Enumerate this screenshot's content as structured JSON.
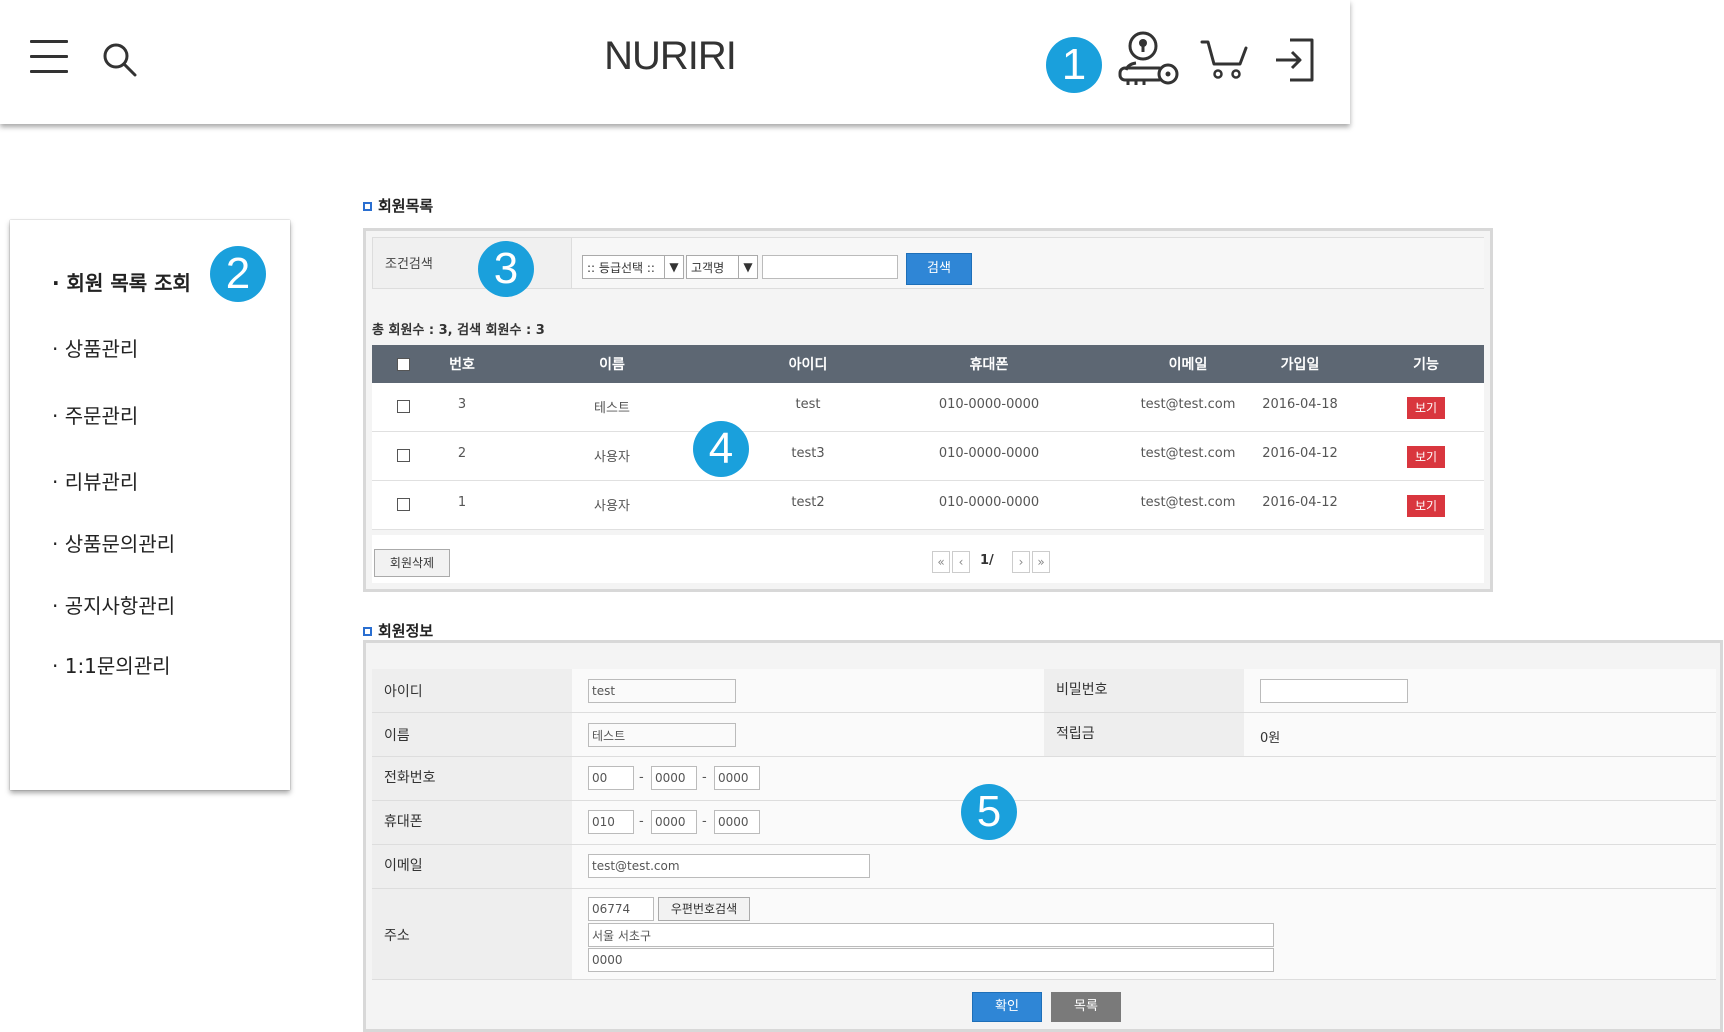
{
  "header": {
    "brand": "NURIRI",
    "icons": [
      "menu-icon",
      "search-icon",
      "admin-key-icon",
      "cart-icon",
      "logout-icon"
    ]
  },
  "callouts": {
    "c1": "1",
    "c2": "2",
    "c3": "3",
    "c4": "4",
    "c5": "5"
  },
  "sidebar": {
    "items": [
      {
        "label": "· 회원 목록 조회"
      },
      {
        "label": "· 상품관리"
      },
      {
        "label": "· 주문관리"
      },
      {
        "label": "· 리뷰관리"
      },
      {
        "label": "· 상품문의관리"
      },
      {
        "label": "· 공지사항관리"
      },
      {
        "label": "· 1:1문의관리"
      }
    ]
  },
  "member_list": {
    "title": "회원목록",
    "search": {
      "label": "조건검색",
      "grade_select": ":: 등급선택 ::",
      "field_select": "고객명",
      "keyword": "",
      "button": "검색"
    },
    "count_text": "총 회원수 : 3, 검색 회원수 : 3",
    "columns": [
      "번호",
      "이름",
      "아이디",
      "휴대폰",
      "이메일",
      "가입일",
      "기능"
    ],
    "rows": [
      {
        "no": "3",
        "name": "테스트",
        "id": "test",
        "phone": "010-0000-0000",
        "email": "test@test.com",
        "joined": "2016-04-18",
        "action": "보기"
      },
      {
        "no": "2",
        "name": "사용자",
        "id": "test3",
        "phone": "010-0000-0000",
        "email": "test@test.com",
        "joined": "2016-04-12",
        "action": "보기"
      },
      {
        "no": "1",
        "name": "사용자",
        "id": "test2",
        "phone": "010-0000-0000",
        "email": "test@test.com",
        "joined": "2016-04-12",
        "action": "보기"
      }
    ],
    "delete_button": "회원삭제",
    "pagination": {
      "first": "«",
      "prev": "‹",
      "page": "1/",
      "next": "›",
      "last": "»"
    }
  },
  "member_info": {
    "title": "회원정보",
    "labels": {
      "id": "아이디",
      "password": "비밀번호",
      "name": "이름",
      "points": "적립금",
      "tel": "전화번호",
      "mobile": "휴대폰",
      "email": "이메일",
      "address": "주소"
    },
    "values": {
      "id": "test",
      "password": "",
      "name": "테스트",
      "points": "0원",
      "tel1": "00",
      "tel2": "0000",
      "tel3": "0000",
      "mobile1": "010",
      "mobile2": "0000",
      "mobile3": "0000",
      "email": "test@test.com",
      "zipcode": "06774",
      "address1": "서울 서초구",
      "address2": "0000"
    },
    "zip_search_button": "우편번호검색",
    "confirm_button": "확인",
    "list_button": "목록"
  },
  "colors": {
    "accent": "#1aa0dc",
    "header_row": "#5d6773",
    "view_button": "#d9363e",
    "primary_button": "#2f86d6"
  }
}
